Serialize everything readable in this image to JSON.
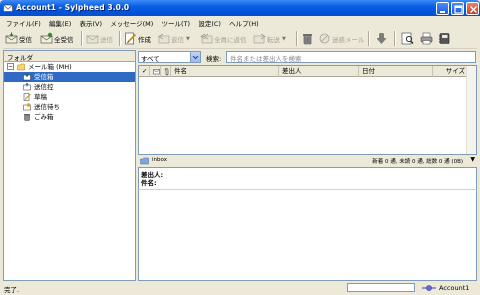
{
  "window": {
    "title": "Account1 - Sylpheed 3.0.0"
  },
  "menu": [
    "ファイル(F)",
    "編集(E)",
    "表示(V)",
    "メッセージ(M)",
    "ツール(T)",
    "設定(C)",
    "ヘルプ(H)"
  ],
  "toolbar": {
    "receive": "受信",
    "receive_all": "全受信",
    "send": "送信",
    "compose": "作成",
    "reply": "返信",
    "reply_all": "全員に返信",
    "forward": "転送",
    "junk": "迷惑メール"
  },
  "folders": {
    "header": "フォルダ",
    "mailbox": "メール箱 (MH)",
    "items": [
      "受信箱",
      "送信控",
      "草稿",
      "送信待ち",
      "ごみ箱"
    ]
  },
  "filter": {
    "selected": "すべて",
    "search_label": "検索:",
    "search_placeholder": "件名または差出人を検索"
  },
  "columns": {
    "check": "✓",
    "subject": "件名",
    "from": "差出人",
    "date": "日付",
    "size": "サイズ"
  },
  "folder_status": {
    "name": "inbox",
    "counts": "新着 0 通, 未読 0 通, 総数 0 通 (0B)"
  },
  "preview": {
    "from_label": "差出人:",
    "subject_label": "件名:"
  },
  "statusbar": {
    "text": "完了.",
    "account": "Account1"
  },
  "colors": {
    "titlebar": "#0054e3",
    "selection": "#316ac5",
    "face": "#ece9d8"
  }
}
